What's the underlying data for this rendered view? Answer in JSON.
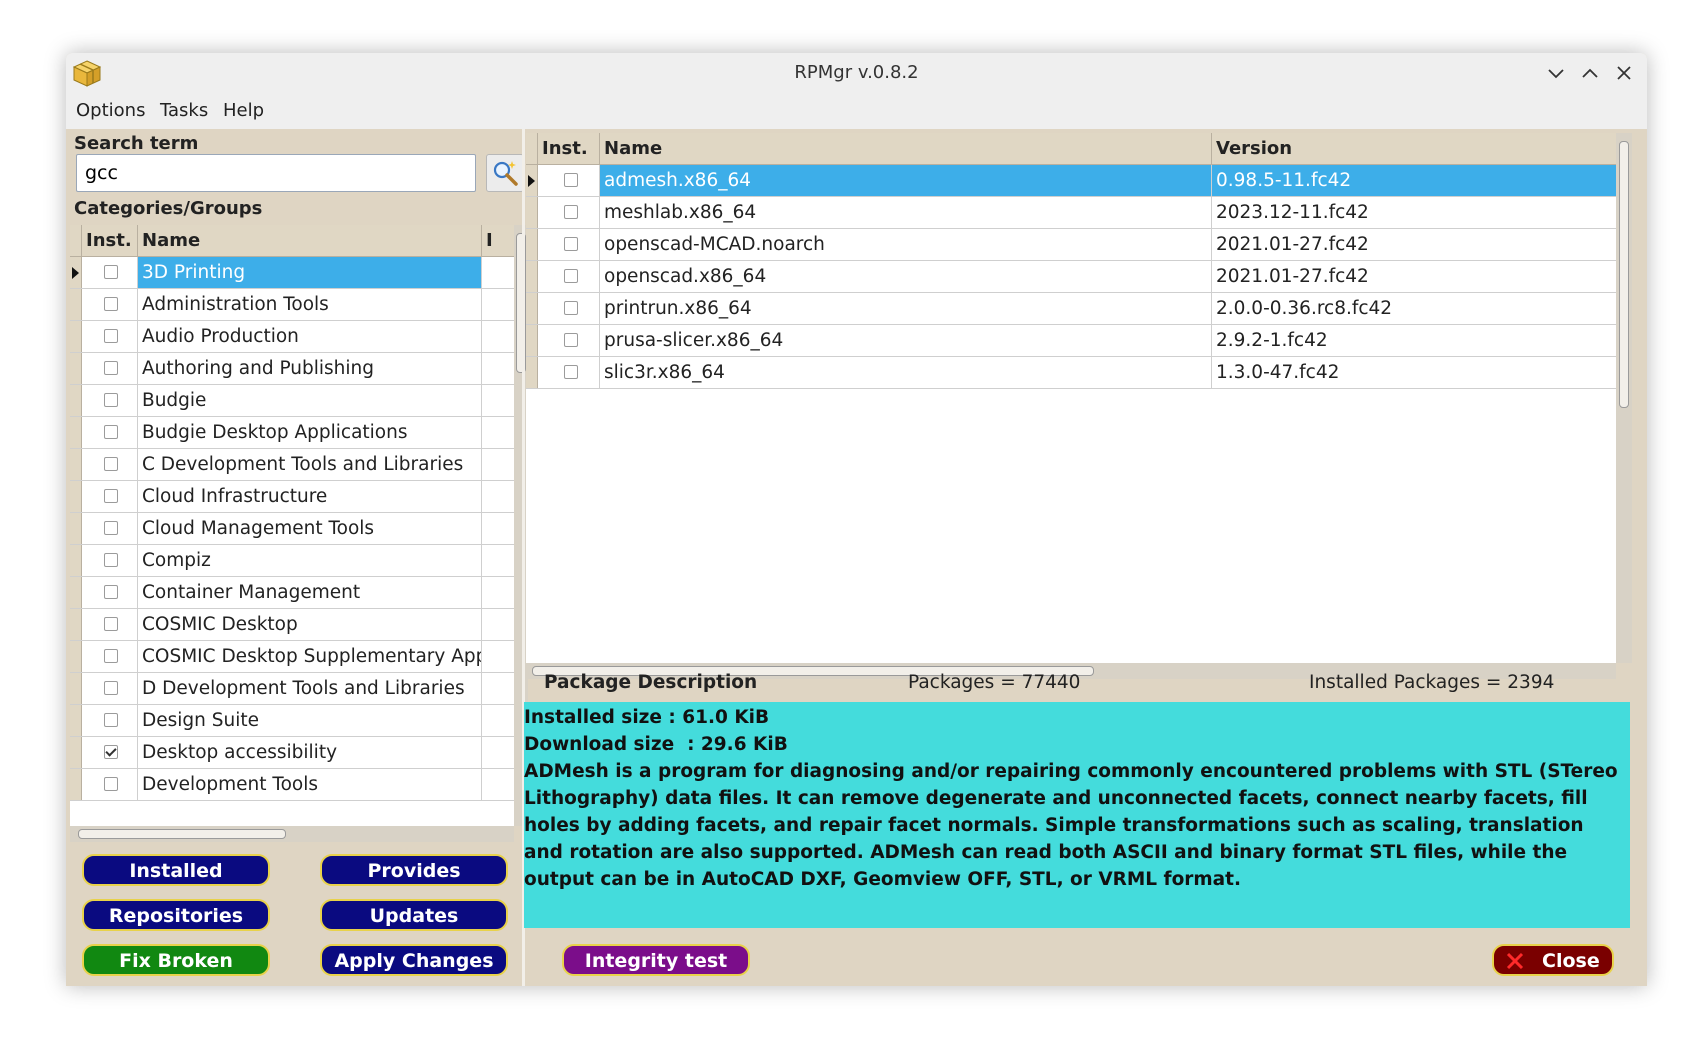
{
  "window": {
    "title": "RPMgr v.0.8.2"
  },
  "menu": [
    "Options",
    "Tasks",
    "Help"
  ],
  "search": {
    "label": "Search term",
    "value": "gcc"
  },
  "categories": {
    "label": "Categories/Groups",
    "headers": {
      "inst": "Inst.",
      "name": "Name",
      "extra": "I"
    },
    "items": [
      {
        "name": "3D Printing",
        "checked": false,
        "selected": true
      },
      {
        "name": "Administration Tools",
        "checked": false
      },
      {
        "name": "Audio Production",
        "checked": false
      },
      {
        "name": "Authoring and Publishing",
        "checked": false
      },
      {
        "name": "Budgie",
        "checked": false
      },
      {
        "name": "Budgie Desktop Applications",
        "checked": false
      },
      {
        "name": "C Development Tools and Libraries",
        "checked": false
      },
      {
        "name": "Cloud Infrastructure",
        "checked": false
      },
      {
        "name": "Cloud Management Tools",
        "checked": false
      },
      {
        "name": "Compiz",
        "checked": false
      },
      {
        "name": "Container Management",
        "checked": false
      },
      {
        "name": "COSMIC Desktop",
        "checked": false
      },
      {
        "name": "COSMIC Desktop Supplementary App",
        "checked": false
      },
      {
        "name": "D Development Tools and Libraries",
        "checked": false
      },
      {
        "name": "Design Suite",
        "checked": false
      },
      {
        "name": "Desktop accessibility",
        "checked": true
      },
      {
        "name": "Development Tools",
        "checked": false
      }
    ]
  },
  "packages": {
    "headers": {
      "inst": "Inst.",
      "name": "Name",
      "version": "Version"
    },
    "items": [
      {
        "name": "admesh.x86_64",
        "version": "0.98.5-11.fc42",
        "checked": false,
        "selected": true
      },
      {
        "name": "meshlab.x86_64",
        "version": "2023.12-11.fc42",
        "checked": false
      },
      {
        "name": "openscad-MCAD.noarch",
        "version": "2021.01-27.fc42",
        "checked": false
      },
      {
        "name": "openscad.x86_64",
        "version": "2021.01-27.fc42",
        "checked": false
      },
      {
        "name": "printrun.x86_64",
        "version": "2.0.0-0.36.rc8.fc42",
        "checked": false
      },
      {
        "name": "prusa-slicer.x86_64",
        "version": "2.9.2-1.fc42",
        "checked": false
      },
      {
        "name": "slic3r.x86_64",
        "version": "1.3.0-47.fc42",
        "checked": false
      }
    ]
  },
  "buttons": {
    "installed": "Installed",
    "provides": "Provides",
    "repositories": "Repositories",
    "updates": "Updates",
    "fix_broken": "Fix Broken",
    "apply_changes": "Apply Changes",
    "integrity_test": "Integrity test",
    "close": "Close"
  },
  "description": {
    "title": "Package Description",
    "packages_count": "Packages = 77440",
    "installed_count": "Installed Packages = 2394",
    "installed_size": "Installed size : 61.0 KiB",
    "download_size": "Download size  : 29.6 KiB",
    "text": " ADMesh is a program for diagnosing and/or repairing commonly encountered problems with STL (STereo Lithography) data files. It can remove degenerate and unconnected facets, connect nearby facets, fill holes by adding facets, and repair facet normals. Simple transformations such as scaling, translation and rotation are also supported. ADMesh can read both ASCII and binary format STL files, while the output can be in AutoCAD DXF, Geomview OFF, STL, or VRML format."
  },
  "colors": {
    "selection": "#3daee9",
    "window_bg": "#dfd5c3",
    "description_bg": "#44dcdc",
    "button_navy": "#0a0a80",
    "button_green": "#118811",
    "button_purple": "#7b0d8a",
    "button_maroon": "#7a0000",
    "button_border": "#e8d24a"
  }
}
